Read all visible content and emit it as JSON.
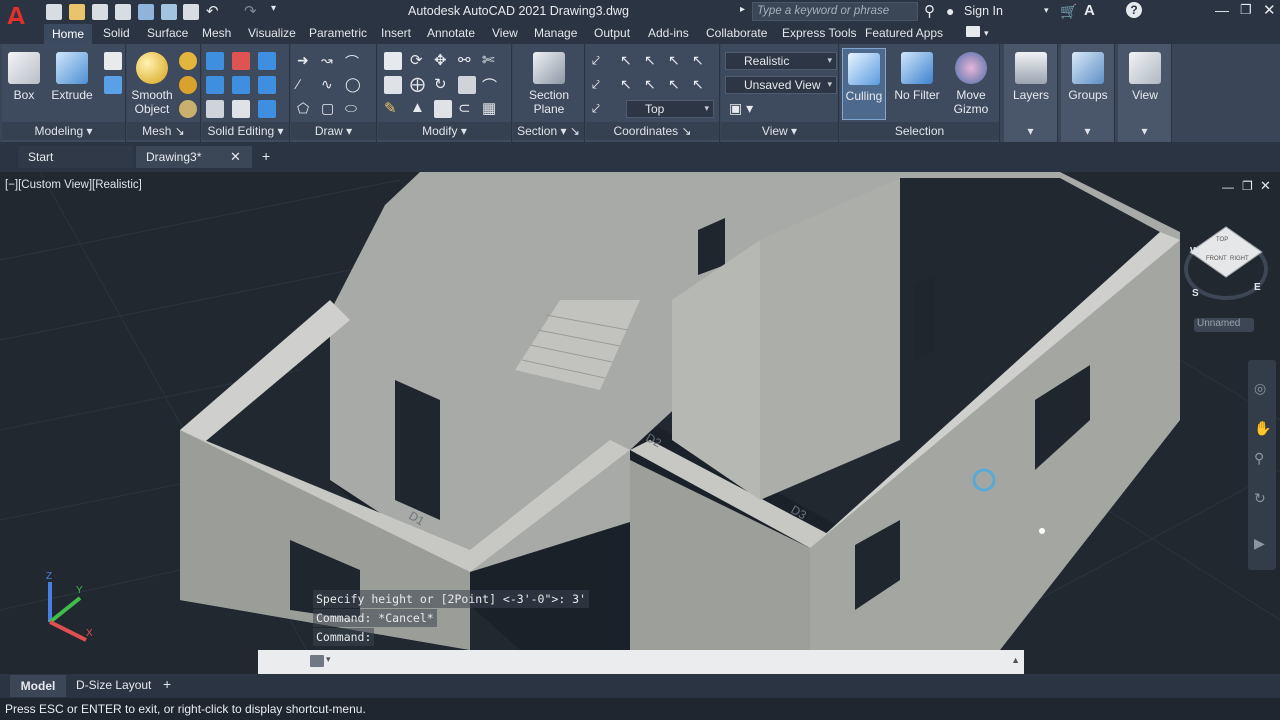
{
  "app": {
    "logo_letter": "A",
    "title": "Autodesk AutoCAD 2021   Drawing3.dwg",
    "search_placeholder": "Type a keyword or phrase",
    "sign_in": "Sign In"
  },
  "ribbon_tabs": [
    "Home",
    "Solid",
    "Surface",
    "Mesh",
    "Visualize",
    "Parametric",
    "Insert",
    "Annotate",
    "View",
    "Manage",
    "Output",
    "Add-ins",
    "Collaborate",
    "Express Tools",
    "Featured Apps"
  ],
  "ribbon": {
    "modeling": {
      "title": "Modeling",
      "box": "Box",
      "extrude": "Extrude"
    },
    "mesh": {
      "title": "Mesh",
      "smooth_object_1": "Smooth",
      "smooth_object_2": "Object"
    },
    "solid_editing": {
      "title": "Solid Editing"
    },
    "draw": {
      "title": "Draw"
    },
    "modify": {
      "title": "Modify"
    },
    "section": {
      "title": "Section",
      "plane_1": "Section",
      "plane_2": "Plane"
    },
    "coordinates": {
      "title": "Coordinates"
    },
    "view": {
      "title": "View",
      "visual_style": "Realistic",
      "named_view": "Unsaved View",
      "view_dir": "Top"
    },
    "selection": {
      "title": "Selection",
      "culling": "Culling",
      "no_filter": "No Filter",
      "move_gizmo_1": "Move",
      "move_gizmo_2": "Gizmo"
    },
    "layers": "Layers",
    "groups": "Groups",
    "view_btn": "View"
  },
  "file_tabs": {
    "start": "Start",
    "drawing": "Drawing3*"
  },
  "viewport": {
    "label": "[−][Custom View][Realistic]",
    "viewcube_top": "TOP",
    "viewcube_front": "FRONT",
    "viewcube_right": "RIGHT",
    "compass_w": "W",
    "compass_s": "S",
    "compass_e": "E",
    "ucs_name": "Unnamed"
  },
  "command": {
    "history": [
      "Specify height or [2Point] <-3'-0\">: 3'",
      "Command: *Cancel*",
      "Command:"
    ]
  },
  "layout_tabs": {
    "model": "Model",
    "layout": "D-Size Layout"
  },
  "status": "Press ESC or ENTER to exit, or right-click to display shortcut-menu."
}
